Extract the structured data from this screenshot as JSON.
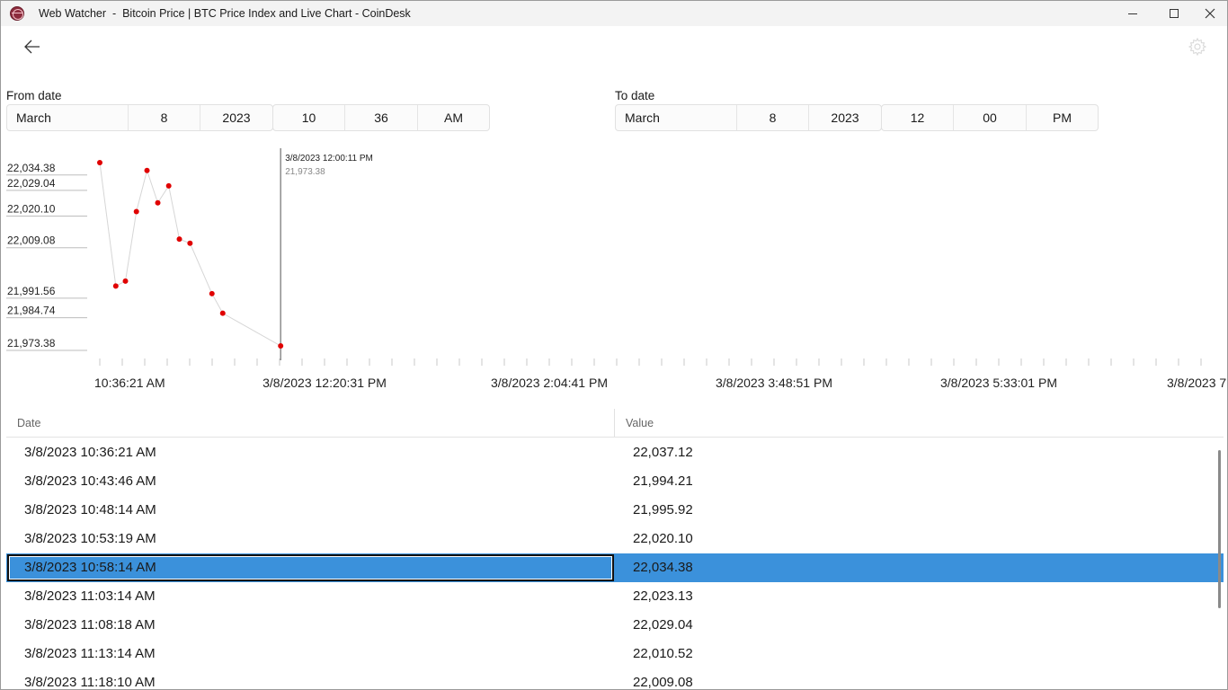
{
  "window": {
    "title": "Web Watcher  -  Bitcoin Price | BTC Price Index and Live Chart - CoinDesk"
  },
  "header": {
    "back_icon": "arrow-left-icon",
    "settings_icon": "gear-icon"
  },
  "from_date": {
    "label": "From date",
    "month": "March",
    "day": "8",
    "year": "2023",
    "hour": "10",
    "minute": "36",
    "ampm": "AM"
  },
  "to_date": {
    "label": "To date",
    "month": "March",
    "day": "8",
    "year": "2023",
    "hour": "12",
    "minute": "00",
    "ampm": "PM"
  },
  "chart_data": {
    "type": "line",
    "series_color": "#e00000",
    "line_color": "#d6d6d6",
    "y_tick_labels": [
      "22,034.38",
      "22,029.04",
      "22,020.10",
      "22,009.08",
      "21,991.56",
      "21,984.74",
      "21,973.38"
    ],
    "x_tick_labels": [
      "10:36:21 AM",
      "3/8/2023 12:20:31 PM",
      "3/8/2023 2:04:41 PM",
      "3/8/2023 3:48:51 PM",
      "3/8/2023 5:33:01 PM",
      "3/8/2023 7"
    ],
    "x_ticks_seconds": [
      38181,
      44431,
      50681,
      56931,
      63181,
      69431
    ],
    "y_ticks": [
      22034.38,
      22029.04,
      22020.1,
      22009.08,
      21991.56,
      21984.74,
      21973.38
    ],
    "points": [
      {
        "t": 38181,
        "y": 22037.12
      },
      {
        "t": 38626,
        "y": 21994.21
      },
      {
        "t": 38894,
        "y": 21995.92
      },
      {
        "t": 39199,
        "y": 22020.1
      },
      {
        "t": 39494,
        "y": 22034.38
      },
      {
        "t": 39794,
        "y": 22023.13
      },
      {
        "t": 40098,
        "y": 22029.04
      },
      {
        "t": 40394,
        "y": 22010.52
      },
      {
        "t": 40690,
        "y": 22009.08
      },
      {
        "t": 41300,
        "y": 21991.56
      },
      {
        "t": 41600,
        "y": 21984.74
      },
      {
        "t": 43211,
        "y": 21973.38
      }
    ],
    "cursor": {
      "t": 43211,
      "label": "3/8/2023 12:00:11 PM",
      "value": "21,973.38"
    }
  },
  "grid": {
    "columns": [
      "Date",
      "Value"
    ],
    "selected_index": 4,
    "rows": [
      {
        "date": "3/8/2023 10:36:21 AM",
        "value": "22,037.12"
      },
      {
        "date": "3/8/2023 10:43:46 AM",
        "value": "21,994.21"
      },
      {
        "date": "3/8/2023 10:48:14 AM",
        "value": "21,995.92"
      },
      {
        "date": "3/8/2023 10:53:19 AM",
        "value": "22,020.10"
      },
      {
        "date": "3/8/2023 10:58:14 AM",
        "value": "22,034.38"
      },
      {
        "date": "3/8/2023 11:03:14 AM",
        "value": "22,023.13"
      },
      {
        "date": "3/8/2023 11:08:18 AM",
        "value": "22,029.04"
      },
      {
        "date": "3/8/2023 11:13:14 AM",
        "value": "22,010.52"
      },
      {
        "date": "3/8/2023 11:18:10 AM",
        "value": "22,009.08"
      }
    ]
  }
}
